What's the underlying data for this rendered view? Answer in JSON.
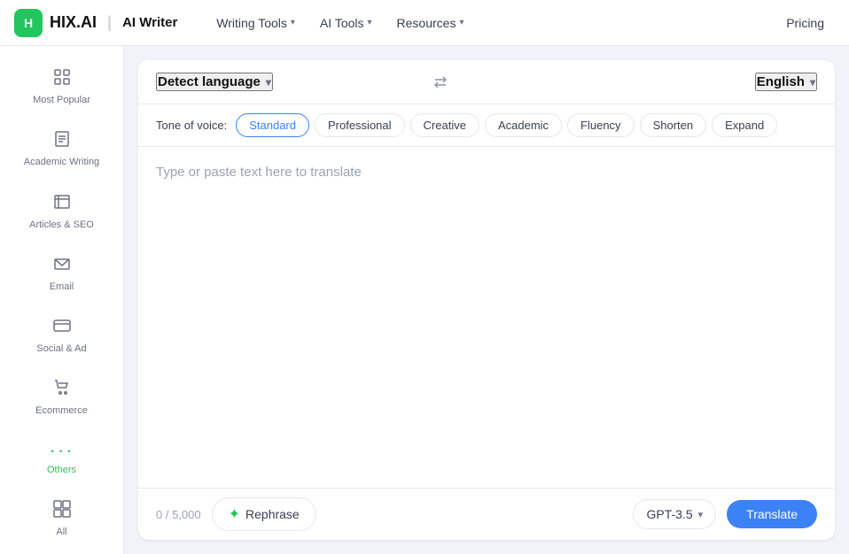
{
  "brand": {
    "logo_text": "H",
    "name": "HIX.AI",
    "divider": "|",
    "subtitle": "AI Writer"
  },
  "nav": {
    "writing_tools_label": "Writing Tools",
    "ai_tools_label": "AI Tools",
    "resources_label": "Resources",
    "pricing_label": "Pricing"
  },
  "sidebar": {
    "items": [
      {
        "id": "most-popular",
        "label": "Most Popular",
        "icon": "⊞"
      },
      {
        "id": "academic-writing",
        "label": "Academic Writing",
        "icon": "✎"
      },
      {
        "id": "articles-seo",
        "label": "Articles & SEO",
        "icon": "▣"
      },
      {
        "id": "email",
        "label": "Email",
        "icon": "✉"
      },
      {
        "id": "social-ad",
        "label": "Social & Ad",
        "icon": "▭"
      },
      {
        "id": "ecommerce",
        "label": "Ecommerce",
        "icon": "🛒"
      },
      {
        "id": "others",
        "label": "Others",
        "icon": "···",
        "active": true
      },
      {
        "id": "all",
        "label": "All",
        "icon": "⊞⊞"
      }
    ]
  },
  "tool": {
    "source_lang_label": "Detect language",
    "swap_icon": "⇌",
    "target_lang_label": "English",
    "tone_label": "Tone of voice:",
    "tones": [
      {
        "id": "standard",
        "label": "Standard",
        "active": true
      },
      {
        "id": "professional",
        "label": "Professional",
        "active": false
      },
      {
        "id": "creative",
        "label": "Creative",
        "active": false
      },
      {
        "id": "academic",
        "label": "Academic",
        "active": false
      },
      {
        "id": "fluency",
        "label": "Fluency",
        "active": false
      },
      {
        "id": "shorten",
        "label": "Shorten",
        "active": false
      },
      {
        "id": "expand",
        "label": "Expand",
        "active": false
      }
    ],
    "placeholder": "Type or paste text here to translate",
    "char_count": "0 / 5,000",
    "rephrase_label": "Rephrase",
    "gpt_label": "GPT-3.5",
    "translate_label": "Translate"
  }
}
